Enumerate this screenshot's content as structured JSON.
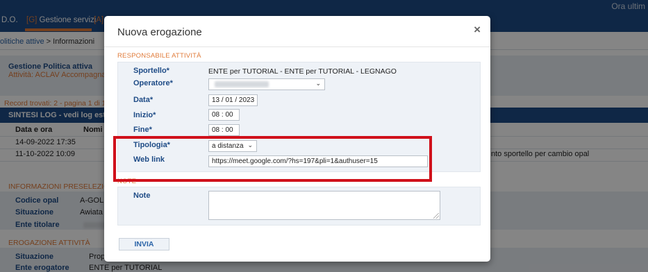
{
  "nav": {
    "items": [
      {
        "text": "D.O."
      },
      {
        "key": "[G]",
        "text": "Gestione servizi"
      },
      {
        "key": "[A]",
        "text": "A"
      }
    ],
    "orario": "Ora ultim"
  },
  "breadcrumb": {
    "link": "olitiche attive",
    "current": "> Informazioni"
  },
  "background": {
    "gestione_title": "Gestione Politica attiva",
    "attivita": "Attività: ACLAV Accompagnamen",
    "record_trovati": "Record trovati: 2 - pagina 1 di 1",
    "sintesi_header": "SINTESI LOG - vedi log estese (",
    "table_headers": [
      "Data e ora",
      "Nomi"
    ],
    "rows": [
      {
        "date": "14-09-2022 17:35"
      },
      {
        "date": "11-10-2022 10:09",
        "note": "nto sportello per cambio opal"
      }
    ],
    "info_section": "INFORMAZIONI PRESELEZIONE",
    "codice_label": "Codice opal",
    "codice_value": "A-GOL",
    "situazione_label": "Situazione",
    "situazione_value": "Awiata",
    "ente_titolare_label": "Ente titolare",
    "erogazione_section": "EROGAZIONE ATTIVITÀ",
    "situazione2_label": "Situazione",
    "situazione2_value": "Propos",
    "ente_erogatore_label": "Ente erogatore",
    "ente_erogatore_value": "ENTE per TUTORIAL"
  },
  "modal": {
    "title": "Nuova erogazione",
    "close": "×",
    "section_responsabile": "RESPONSABILE ATTIVITÀ",
    "section_note": "NOTE",
    "fields": {
      "sportello_label": "Sportello*",
      "sportello_value": "ENTE per TUTORIAL - ENTE per TUTORIAL - LEGNAGO",
      "operatore_label": "Operatore*",
      "operatore_value": "",
      "data_label": "Data*",
      "data_value": "13 / 01 / 2023",
      "inizio_label": "Inizio*",
      "inizio_value": "08 : 00",
      "fine_label": "Fine*",
      "fine_value": "08 : 00",
      "tipologia_label": "Tipologia*",
      "tipologia_value": "a distanza",
      "weblink_label": "Web link",
      "weblink_value": "https://meet.google.com/?hs=197&pli=1&authuser=15",
      "note_label": "Note",
      "note_value": ""
    },
    "submit_label": "INVIA"
  },
  "colors": {
    "nav_blue": "#1e4b86",
    "accent_orange": "#e07b3a",
    "highlight_red": "#d0111b",
    "form_bg": "#eef2f7"
  },
  "icons": {
    "close": "close-icon",
    "select": "chevron-down-icon",
    "resize": "resize-handle-icon"
  }
}
